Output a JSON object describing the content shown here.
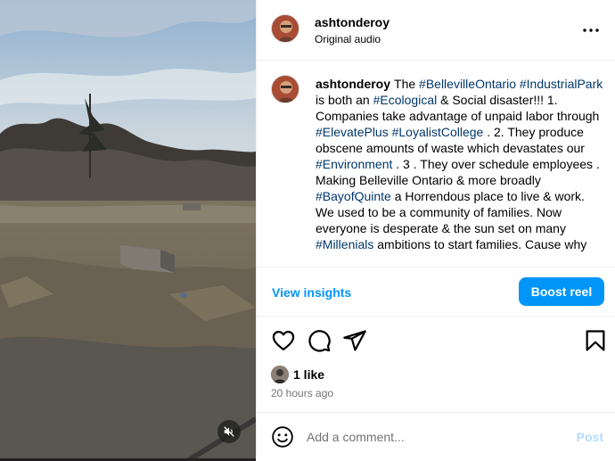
{
  "post": {
    "username": "ashtonderoy",
    "audio": "Original audio"
  },
  "caption": {
    "username": "ashtonderoy",
    "segments": [
      {
        "text": "The ",
        "tag": false
      },
      {
        "text": "#BellevilleOntario",
        "tag": true
      },
      {
        "text": " ",
        "tag": false
      },
      {
        "text": "#IndustrialPark",
        "tag": true
      },
      {
        "text": " is both an ",
        "tag": false
      },
      {
        "text": "#Ecological",
        "tag": true
      },
      {
        "text": " & Social disaster!!! 1. Companies take advantage of unpaid labor through ",
        "tag": false
      },
      {
        "text": "#ElevatePlus",
        "tag": true
      },
      {
        "text": " ",
        "tag": false
      },
      {
        "text": "#LoyalistCollege",
        "tag": true
      },
      {
        "text": " . 2. They produce obscene amounts of waste which devastates our ",
        "tag": false
      },
      {
        "text": "#Environment",
        "tag": true
      },
      {
        "text": " . 3 . They over schedule employees . Making Belleville Ontario & more broadly ",
        "tag": false
      },
      {
        "text": "#BayofQuinte",
        "tag": true
      },
      {
        "text": " a Horrendous place to live & work. We used to be a community of families. Now everyone is desperate & the sun set on many ",
        "tag": false
      },
      {
        "text": "#Millenials",
        "tag": true
      },
      {
        "text": " ambitions to start families. Cause why",
        "tag": false
      }
    ]
  },
  "insights": {
    "view_label": "View insights",
    "boost_label": "Boost reel"
  },
  "engagement": {
    "likes": "1 like",
    "time": "20 hours ago"
  },
  "comment": {
    "placeholder": "Add a comment...",
    "post_label": "Post"
  },
  "icons": {
    "more": "more-options-icon",
    "like": "heart-icon",
    "comment": "comment-icon",
    "share": "share-icon",
    "save": "bookmark-icon",
    "emoji": "emoji-icon",
    "mute": "muted-speaker-icon"
  },
  "colors": {
    "link": "#00376b",
    "accent": "#0095f6",
    "post_disabled": "#b3dbff",
    "muted_text": "#737373"
  }
}
